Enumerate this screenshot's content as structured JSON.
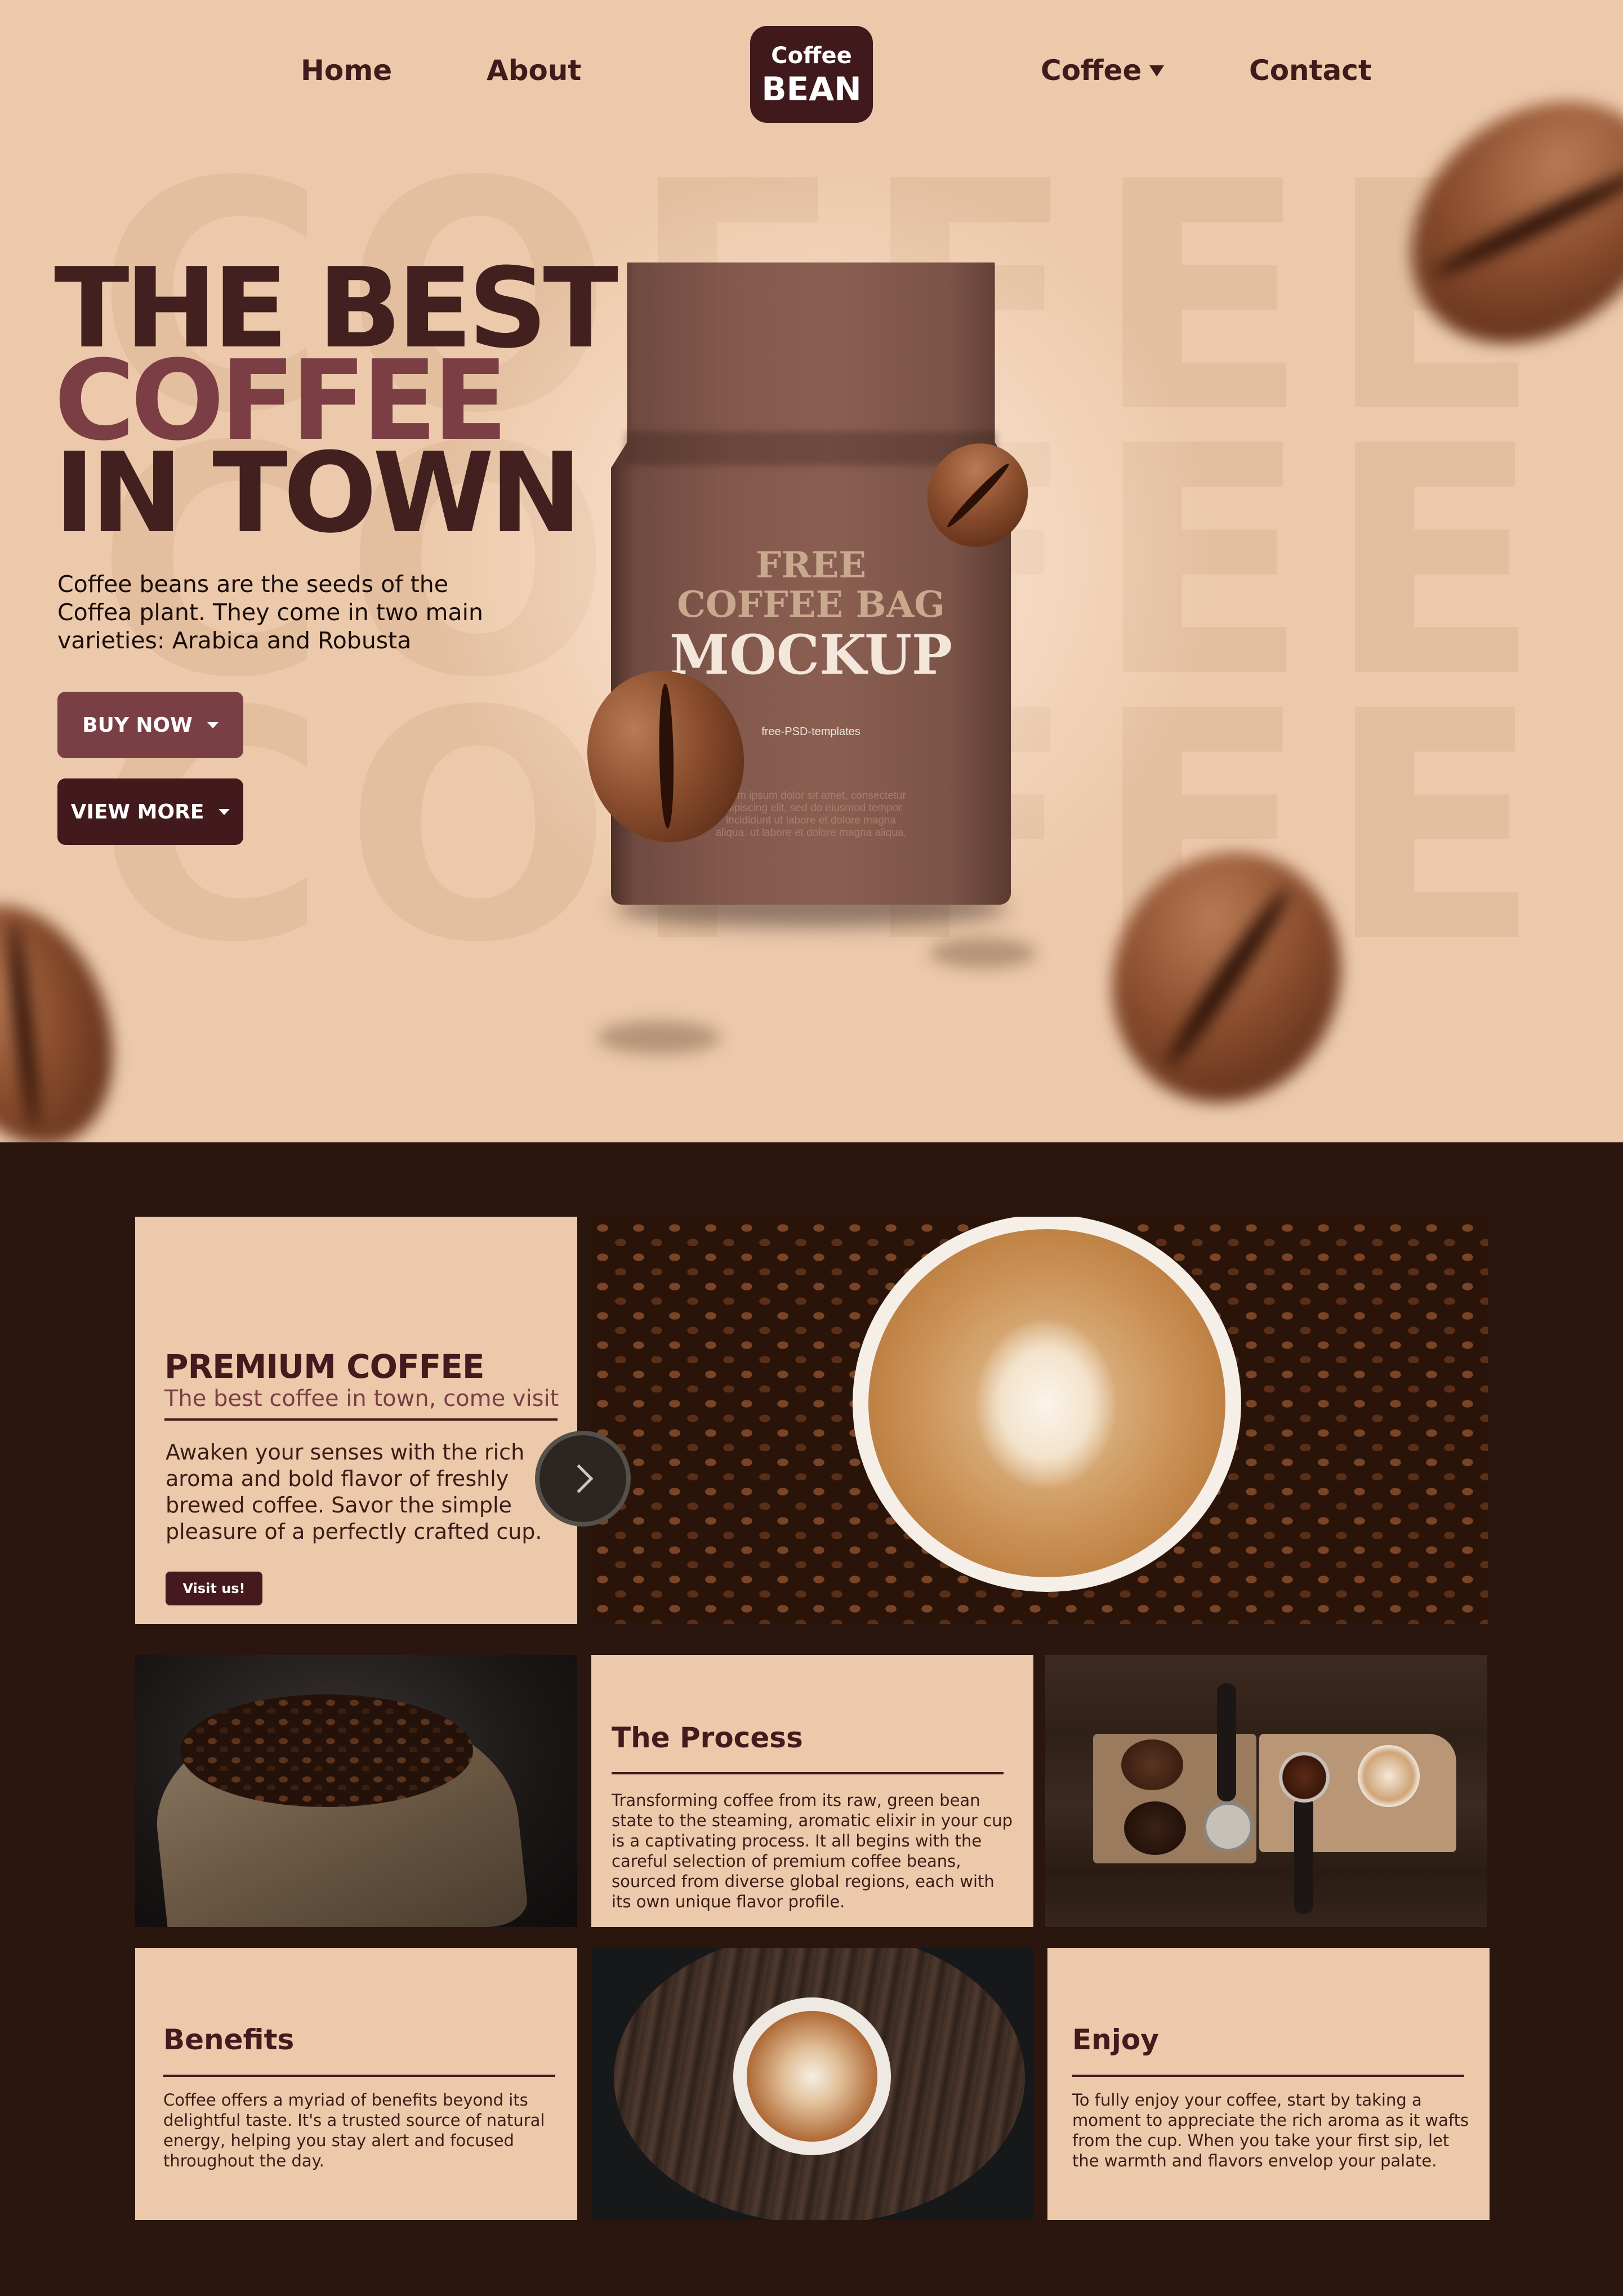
{
  "nav": {
    "home": "Home",
    "about": "About",
    "coffee": "Coffee",
    "contact": "Contact"
  },
  "logo": {
    "line1": "Coffee",
    "line2": "BEAN"
  },
  "hero": {
    "background_word": "COFFEE",
    "headline_line1": "THE BEST",
    "headline_line2": "COFFEE",
    "headline_line3": "IN TOWN",
    "description": "Coffee beans are the seeds of the Coffea plant. They come in two main varieties: Arabica and Robusta",
    "buy_button": "BUY NOW",
    "view_button": "VIEW MORE",
    "bag": {
      "line1": "FREE",
      "line2": "COFFEE BAG",
      "line3": "MOCKUP",
      "brand": "free-PSD-templates",
      "lorem": "Lorem ipsum dolor sit amet, consectetur adipiscing elit, sed do eiusmod tempor incididunt ut labore et dolore magna aliqua. ut labore et dolore magna aliqua."
    }
  },
  "premium": {
    "title": "PREMIUM COFFEE",
    "subtitle": "The best coffee in town, come visit",
    "description": "Awaken your senses with the rich aroma and bold flavor of freshly brewed coffee. Savor the simple pleasure of a perfectly crafted cup.",
    "button": "Visit us!"
  },
  "process": {
    "title": "The Process",
    "description": "Transforming coffee from its raw, green bean state to the steaming, aromatic elixir in your cup is a captivating process. It all begins with the careful selection of premium coffee beans, sourced from diverse global regions, each with its own unique flavor profile."
  },
  "benefits": {
    "title": "Benefits",
    "description": "Coffee offers a myriad of benefits beyond its delightful taste. It's a trusted source of natural energy, helping you stay alert and focused throughout the day."
  },
  "enjoy": {
    "title": "Enjoy",
    "description": "To fully enjoy your coffee, start by taking a moment to appreciate the rich aroma as it wafts from the cup. When you take your first sip, let the warmth and flavors envelop your palate."
  },
  "colors": {
    "hero_bg": "#ecc9ab",
    "dark_bg": "#2a160e",
    "brand_dark": "#45191d",
    "brand_accent": "#7a3e45"
  },
  "icons": [
    "chevron-down-icon",
    "chevron-right-icon"
  ]
}
